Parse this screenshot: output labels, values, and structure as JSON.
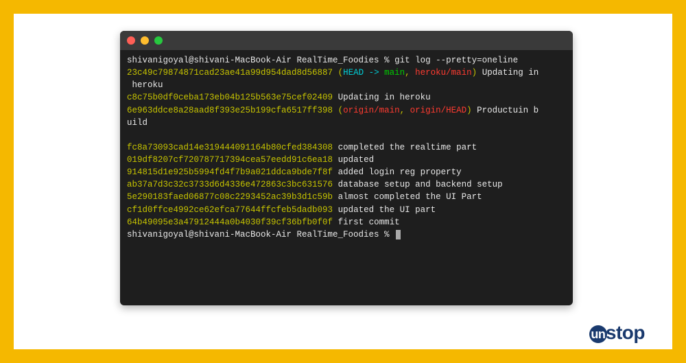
{
  "prompt": "shivanigoyal@shivani-MacBook-Air RealTime_Foodies % ",
  "command": "git log --pretty=oneline",
  "head_label": "HEAD",
  "arrow": " -> ",
  "main_label": "main",
  "heroku_main": "heroku/main",
  "origin_main": "origin/main",
  "origin_head": "origin/HEAD",
  "commits": [
    {
      "hash": "23c49c79874871cad23ae41a99d954dad8d56887",
      "refs": "head",
      "msg": "Updating in",
      "wrap": " heroku"
    },
    {
      "hash": "c8c75b0df0ceba173eb04b125b563e75cef02409",
      "msg": "Updating in heroku"
    },
    {
      "hash": "6e963ddce8a28aad8f393e25b199cfa6517ff398",
      "refs": "origin",
      "msg": "Productuin b",
      "wrap": "uild"
    },
    {
      "hash": "",
      "msg": ""
    },
    {
      "hash": "fc8a73093cad14e319444091164b80cfed384308",
      "msg": "completed the realtime part"
    },
    {
      "hash": "019df8207cf720787717394cea57eedd91c6ea18",
      "msg": "updated"
    },
    {
      "hash": "914815d1e925b5994fd4f7b9a021ddca9bde7f8f",
      "msg": "added login reg property"
    },
    {
      "hash": "ab37a7d3c32c3733d6d4336e472863c3bc631576",
      "msg": "database setup and backend setup"
    },
    {
      "hash": "5e290183faed06877c08c2293452ac39b3d1c59b",
      "msg": "almost completed the UI Part"
    },
    {
      "hash": "cf1d0ffce4992ce62efca77644ffcfeb5dadb093",
      "msg": "updated the UI part"
    },
    {
      "hash": "64b49095e3a47912444a0b4030f39cf36bfb0f0f",
      "msg": "first commit"
    }
  ],
  "logo": {
    "un": "un",
    "stop": "stop"
  }
}
